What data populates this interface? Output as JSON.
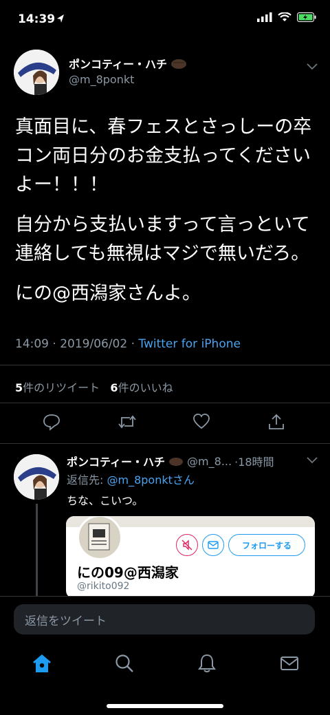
{
  "status": {
    "time": "14:39"
  },
  "tweet": {
    "author_name": "ポンコティー・ハチ",
    "author_handle": "@m_8ponkt",
    "paragraphs": [
      "真面目に、春フェスとさっしーの卒コン両日分のお金支払ってくださいよー！！！",
      "自分から支払いますって言っといて連絡しても無視はマジで無いだろ。",
      "にの@西潟家さんよ。"
    ],
    "timestamp": "14:09 · 2019/06/02 · ",
    "source": "Twitter for iPhone",
    "retweet_count": "5",
    "retweet_label": "件のリツイート",
    "like_count": "6",
    "like_label": "件のいいね"
  },
  "reply": {
    "author_name": "ポンコティー・ハチ",
    "author_handle": "@m_8...",
    "time_ago": "·18時間",
    "reply_to_prefix": "返信先: ",
    "reply_to_handle": "@m_8ponktさん",
    "text": "ちな、こいつ。",
    "card": {
      "display_name": "にの09@西潟家",
      "handle": "@rikito092",
      "follow_label": "フォローする"
    }
  },
  "compose": {
    "placeholder": "返信をツイート"
  },
  "icons": [
    "home-icon",
    "search-icon",
    "notifications-icon",
    "messages-icon",
    "reply-icon",
    "retweet-icon",
    "like-icon",
    "share-icon"
  ],
  "colors": {
    "accent": "#1d9bf0",
    "muted": "#8b98a5",
    "background": "#000000"
  }
}
